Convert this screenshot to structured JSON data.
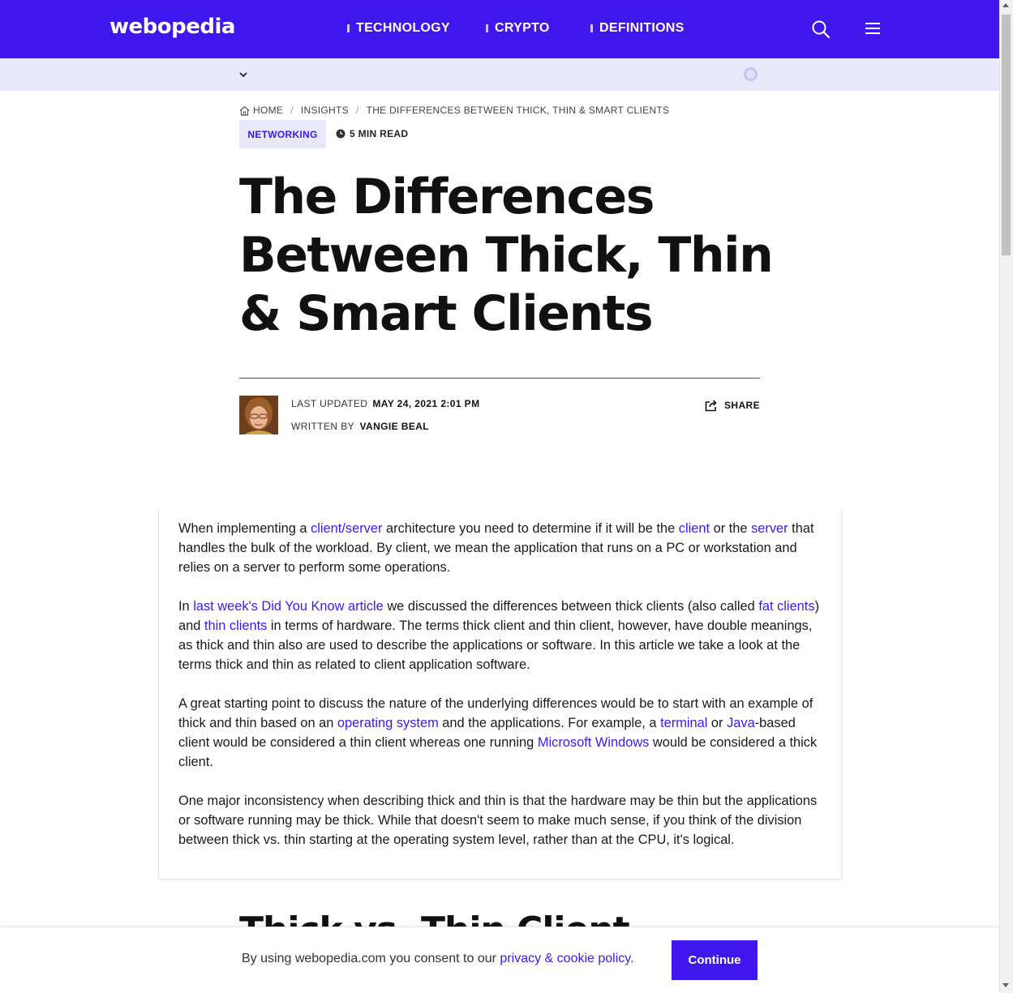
{
  "header": {
    "logo": "webopedia",
    "nav": [
      "TECHNOLOGY",
      "CRYPTO",
      "DEFINITIONS"
    ],
    "search_icon": "search-icon",
    "menu_icon": "hamburger-menu-icon",
    "brand_color": "#3f17ee"
  },
  "breadcrumb": {
    "home": "HOME",
    "sep": "/",
    "section": "INSIGHTS",
    "current": "THE DIFFERENCES BETWEEN THICK, THIN & SMART CLIENTS"
  },
  "article": {
    "tag": "NETWORKING",
    "read_time": "5 MIN READ",
    "title": "The Differences Between Thick, Thin & Smart Clients",
    "last_updated_label": "LAST UPDATED",
    "last_updated": "MAY 24, 2021 2:01 PM",
    "written_by_label": "WRITTEN BY",
    "author": "VANGIE BEAL",
    "share_label": "SHARE",
    "p1": {
      "t1": "When implementing a ",
      "l1": "client/server",
      "t2": " architecture you need to determine if it will be the ",
      "l2": "client",
      "t3": " or the ",
      "l3": "server",
      "t4": " that handles the bulk of the workload. By client, we mean the application that runs on a PC or workstation and relies on a server to perform some operations."
    },
    "p2": {
      "t1": "In ",
      "l1": "last week's Did You Know article",
      "t2": " we discussed the differences between thick clients (also called ",
      "l2": "fat clients",
      "t3": ") and ",
      "l3": "thin clients",
      "t4": " in terms of hardware. The terms thick client and thin client, however, have double meanings, as thick and thin also are used to describe the applications or software. In this article we take a look at the terms thick and thin as related to client application software."
    },
    "p3": {
      "t1": "A great starting point to discuss the nature of the underlying differences would be to start with an example of thick and thin based on an ",
      "l1": "operating system",
      "t2": " and the applications. For example, a ",
      "l2": "terminal",
      "t3": " or ",
      "l3": "Java",
      "t4": "-based client would be considered a thin client whereas one running ",
      "l4": "Microsoft Windows",
      "t5": " would be considered a thick client."
    },
    "p4": "One major inconsistency when describing thick and thin is that the hardware may be thin but the applications or software running may be thick. While that doesn't seem to make much sense, if you think of the division between thick vs. thin starting at the operating system level, rather than at the CPU, it's logical.",
    "next_heading": "Thick vs. Thin Client"
  },
  "consent": {
    "text": "By using webopedia.com you consent to our ",
    "link": "privacy & cookie policy",
    "period": ".",
    "button": "Continue"
  }
}
